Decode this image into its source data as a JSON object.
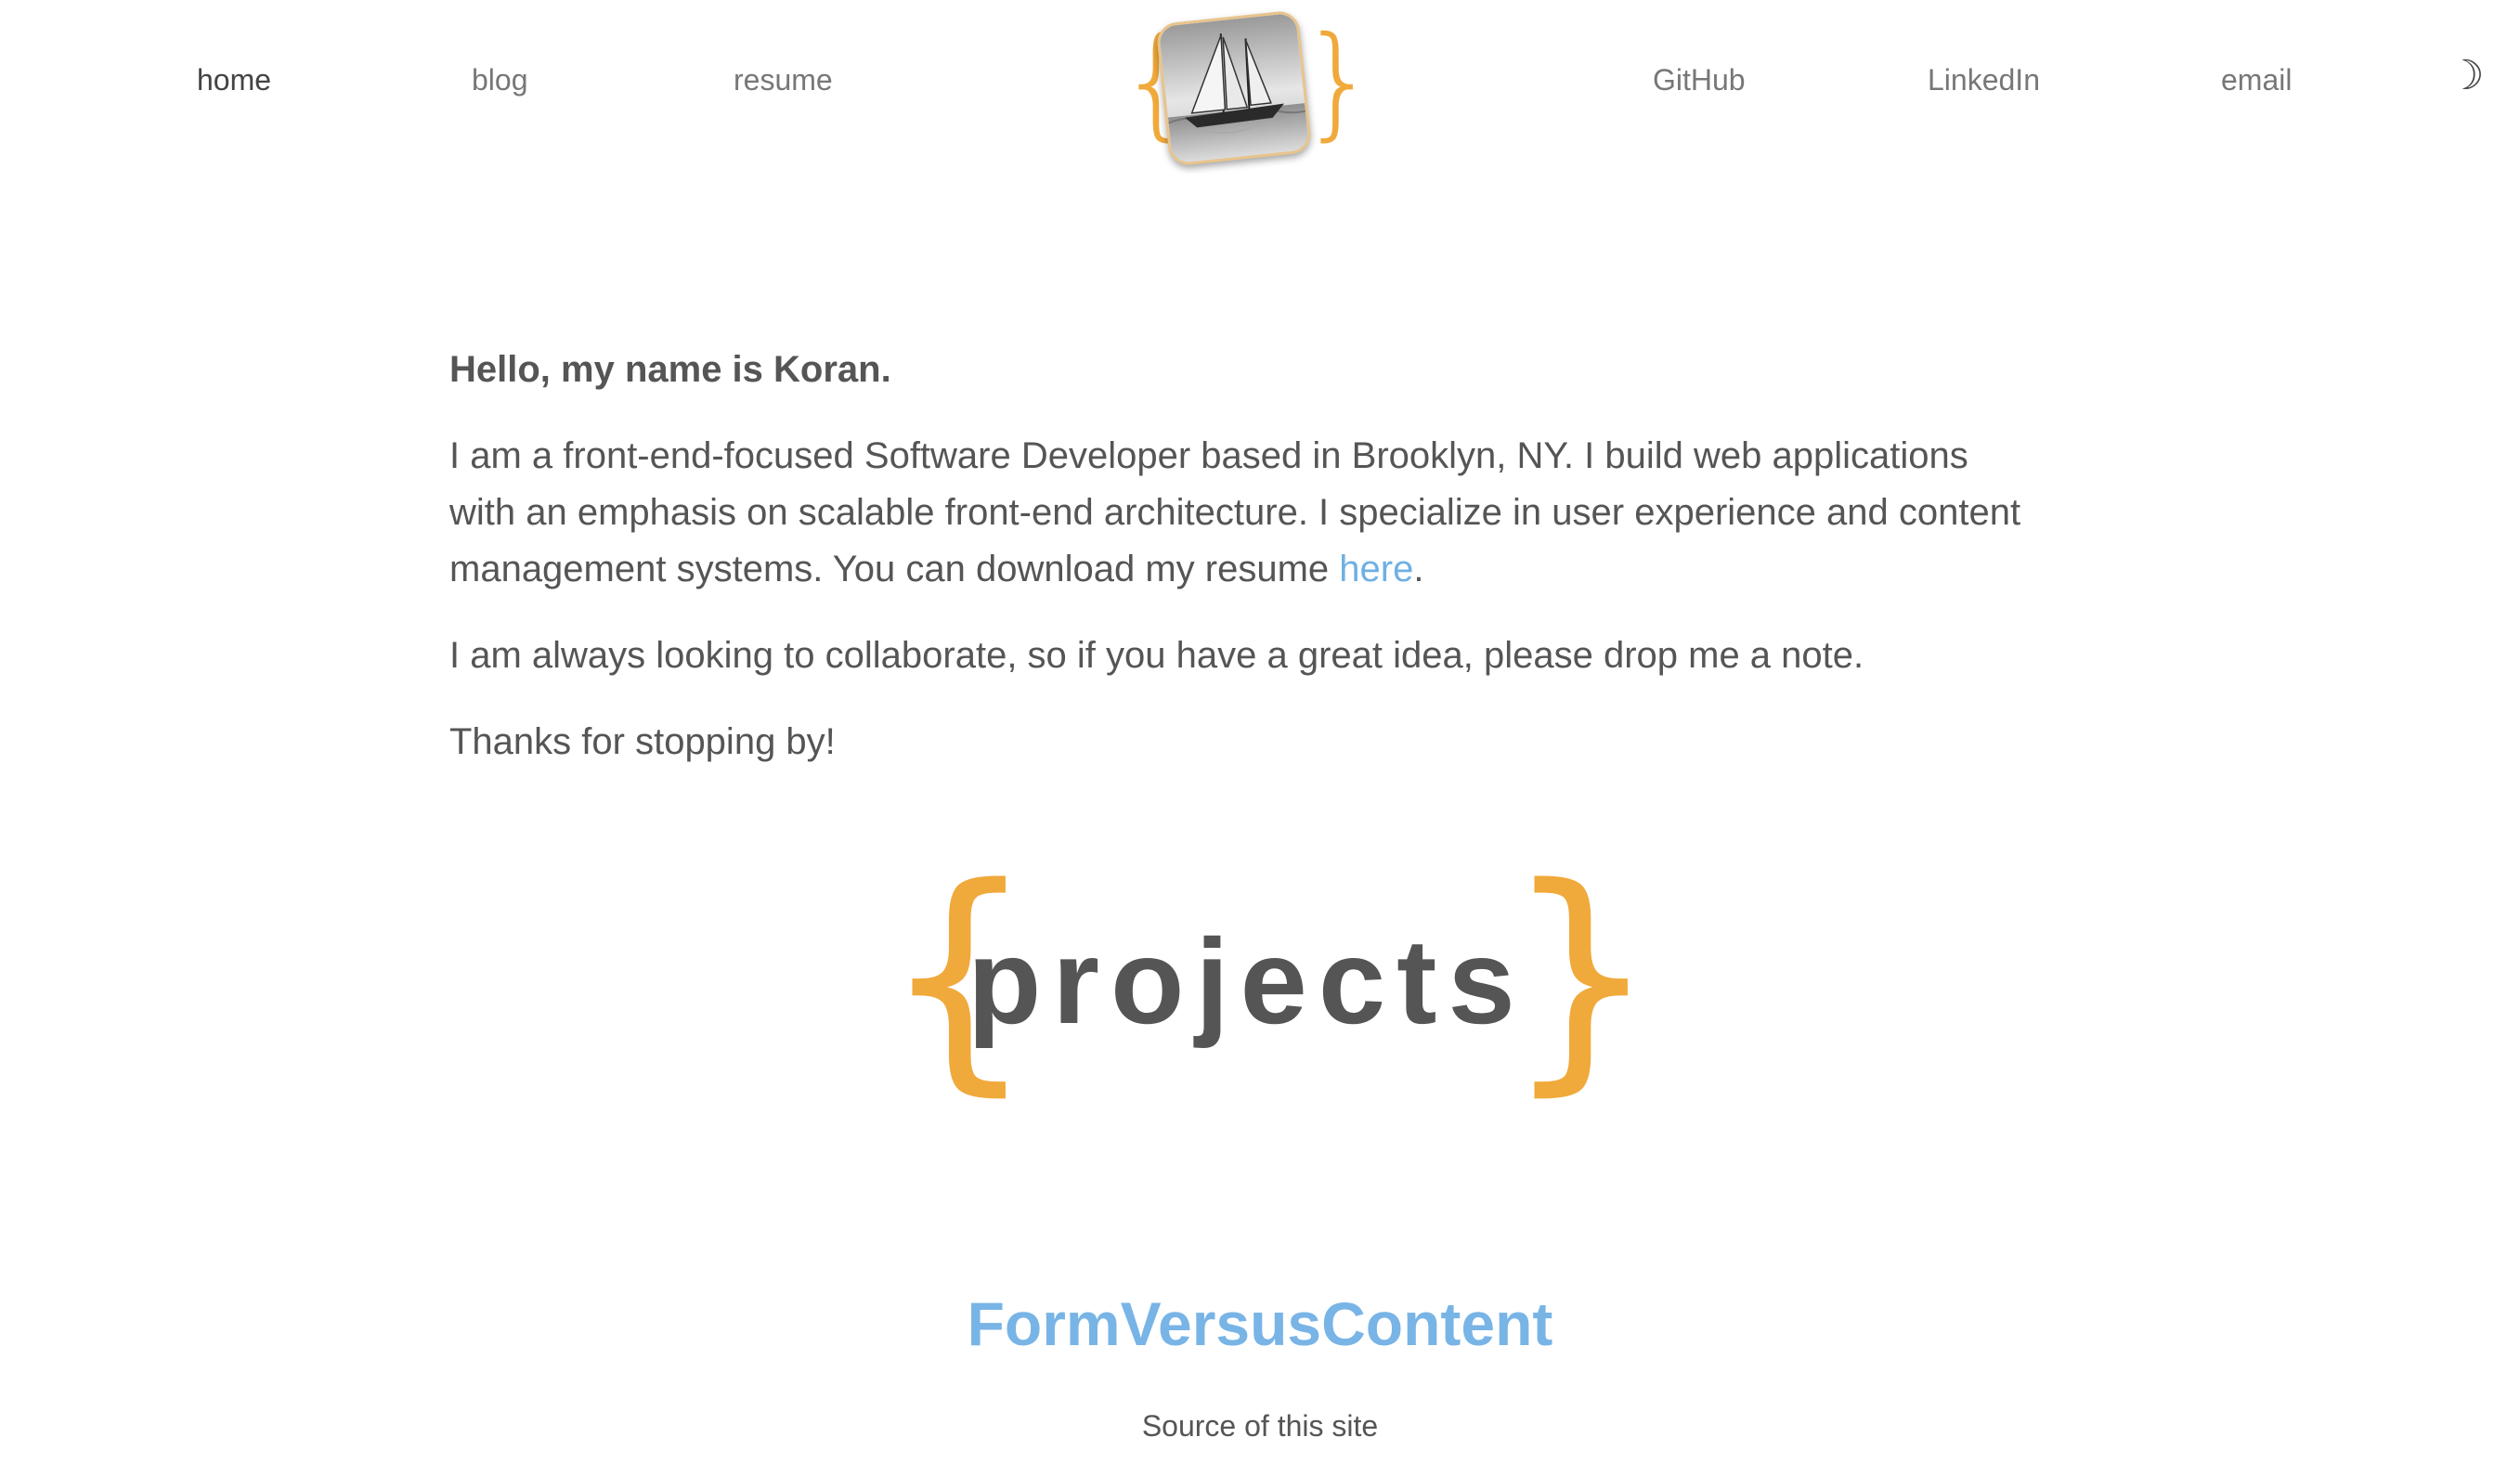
{
  "nav": {
    "home": "home",
    "blog": "blog",
    "resume": "resume",
    "github": "GitHub",
    "linkedin": "LinkedIn",
    "email": "email",
    "theme_toggle_icon": "☽"
  },
  "logo": {
    "brace_left": "{",
    "brace_right": "}",
    "image_icon": "sailboat-avatar"
  },
  "intro": {
    "greeting": "Hello, my name is Koran.",
    "para1_text": "I am a front-end-focused Software Developer based in Brooklyn, NY. I build web applications with an emphasis on scalable front-end architecture. I specialize in user experience and content management systems. You can download my resume ",
    "para1_link": "here",
    "para1_end": ".",
    "para2": "I am always looking to collaborate, so if you have a great idea, please drop me a note.",
    "para3": "Thanks for stopping by!"
  },
  "projects": {
    "brace_left": "{",
    "title": "projects",
    "brace_right": "}",
    "items": [
      {
        "title": "FormVersusContent",
        "description": "Source of this site"
      }
    ]
  },
  "colors": {
    "accent_brace": "#F0A93B",
    "link": "#6FB0E4",
    "text": "#555555"
  }
}
